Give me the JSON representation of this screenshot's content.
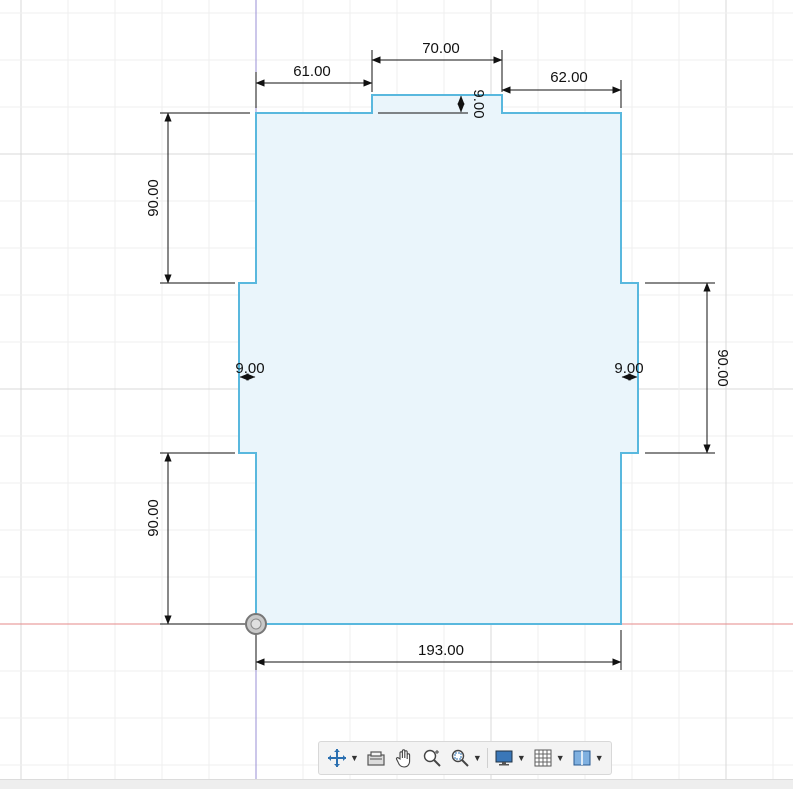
{
  "sketch": {
    "dimensions": {
      "top_left_width": "61.00",
      "top_tab_width": "70.00",
      "top_right_width": "62.00",
      "top_tab_depth": "9.00",
      "left_upper_height": "90.00",
      "left_lower_height": "90.00",
      "left_tab_depth": "9.00",
      "right_tab_depth": "9.00",
      "right_tab_height": "90.00",
      "total_width": "193.00"
    },
    "colors": {
      "profile_stroke": "#59b8de",
      "profile_fill": "#eaf5fb",
      "dimension_line": "#111111",
      "grid_major": "#d9d9d9",
      "grid_minor": "#efefef",
      "x_axis": "#e58a8a",
      "y_axis": "#9a8fd6",
      "origin_marker": "#888888"
    }
  },
  "toolbar": {
    "items": [
      {
        "name": "orbit",
        "icon": "orbit-icon",
        "has_dropdown": true
      },
      {
        "name": "look-at",
        "icon": "look-at-icon",
        "has_dropdown": false
      },
      {
        "name": "pan",
        "icon": "pan-hand-icon",
        "has_dropdown": false
      },
      {
        "name": "zoom",
        "icon": "zoom-icon",
        "has_dropdown": false
      },
      {
        "name": "fit",
        "icon": "zoom-window-icon",
        "has_dropdown": true
      },
      {
        "name": "display-settings",
        "icon": "monitor-icon",
        "has_dropdown": true
      },
      {
        "name": "grid-snaps",
        "icon": "grid-icon",
        "has_dropdown": true
      },
      {
        "name": "viewports",
        "icon": "viewports-icon",
        "has_dropdown": true
      }
    ]
  }
}
